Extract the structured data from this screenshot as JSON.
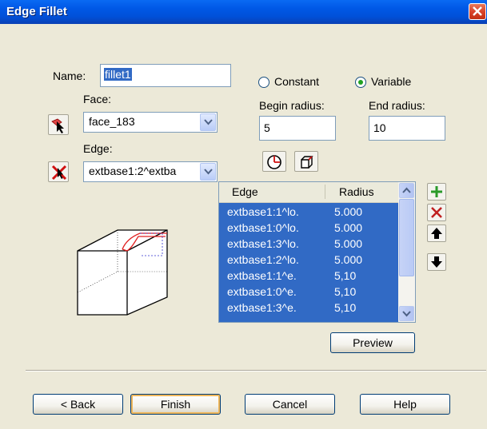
{
  "window": {
    "title": "Edge Fillet"
  },
  "form": {
    "name_label": "Name:",
    "name_value": "fillet1",
    "face_label": "Face:",
    "face_value": "face_183",
    "edge_label": "Edge:",
    "edge_value": "extbase1:2^extba",
    "radio_constant": "Constant",
    "radio_variable": "Variable",
    "selected_mode": "Variable",
    "begin_radius_label": "Begin radius:",
    "begin_radius_value": "5",
    "end_radius_label": "End radius:",
    "end_radius_value": "10"
  },
  "list": {
    "columns": [
      "Edge",
      "Radius"
    ],
    "rows": [
      {
        "edge": "extbase1:1^lo.",
        "radius": "5.000"
      },
      {
        "edge": "extbase1:0^lo.",
        "radius": "5.000"
      },
      {
        "edge": "extbase1:3^lo.",
        "radius": "5.000"
      },
      {
        "edge": "extbase1:2^lo.",
        "radius": "5.000"
      },
      {
        "edge": "extbase1:1^e.",
        "radius": "5,10"
      },
      {
        "edge": "extbase1:0^e.",
        "radius": "5,10"
      },
      {
        "edge": "extbase1:3^e.",
        "radius": "5,10"
      }
    ]
  },
  "buttons": {
    "preview": "Preview",
    "back": "< Back",
    "finish": "Finish",
    "cancel": "Cancel",
    "help": "Help"
  },
  "icons": {
    "face_pick": "face-select-arrow-icon",
    "edge_pick": "edge-remove-icon",
    "pie": "pie-chart-icon",
    "box": "box-3d-icon",
    "add": "plus-icon",
    "delete": "x-delete-icon",
    "up": "arrow-up-icon",
    "down": "arrow-down-icon"
  },
  "colors": {
    "title_bar": "#0058E6",
    "selection": "#316AC5",
    "dialog_bg": "#ECE9D8",
    "add_green": "#2A9A2A",
    "delete_red": "#C02020"
  }
}
